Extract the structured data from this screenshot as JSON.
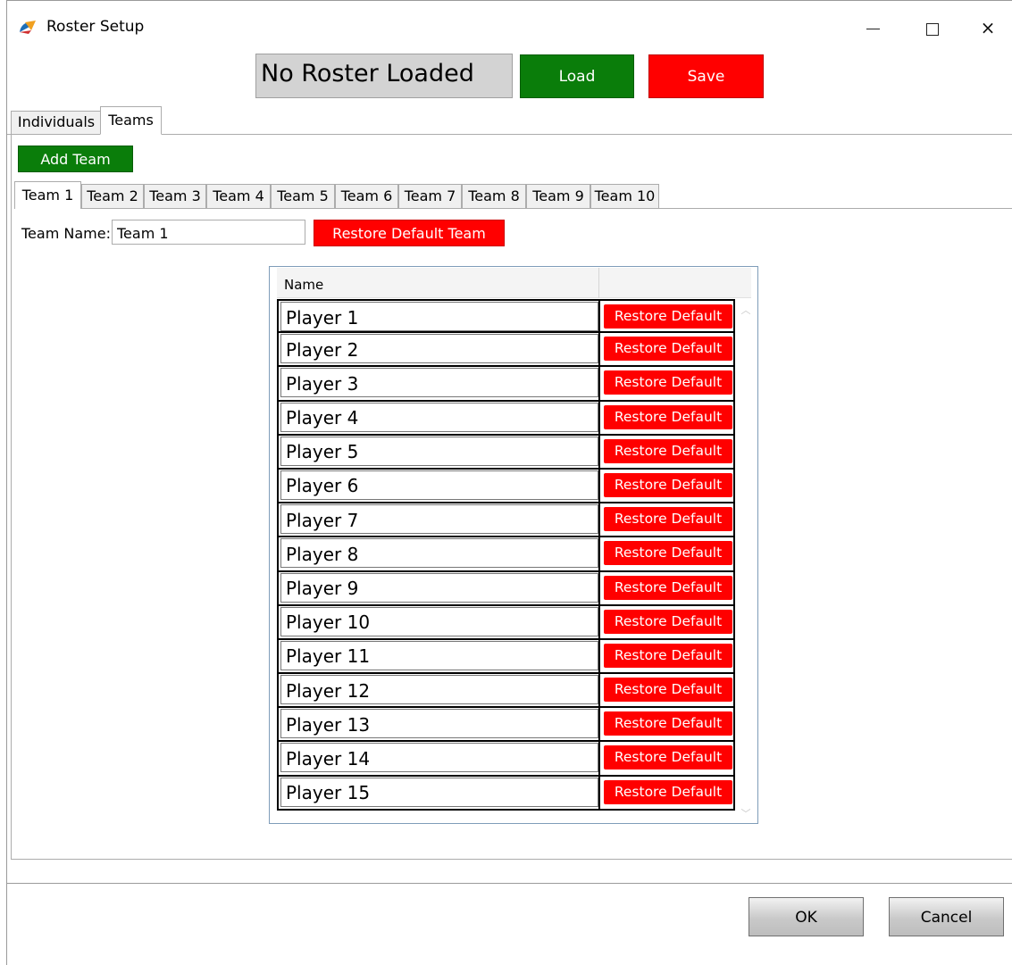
{
  "window": {
    "title": "Roster Setup",
    "minimize_label": "minimize",
    "maximize_label": "maximize",
    "close_label": "×"
  },
  "header": {
    "roster_status": "No Roster Loaded",
    "load_label": "Load",
    "save_label": "Save"
  },
  "main_tabs": [
    {
      "label": "Individuals",
      "active": false
    },
    {
      "label": "Teams",
      "active": true
    }
  ],
  "teams_panel": {
    "add_team_label": "Add Team",
    "team_tabs": [
      {
        "label": "Team 1",
        "active": true
      },
      {
        "label": "Team 2",
        "active": false
      },
      {
        "label": "Team 3",
        "active": false
      },
      {
        "label": "Team 4",
        "active": false
      },
      {
        "label": "Team 5",
        "active": false
      },
      {
        "label": "Team 6",
        "active": false
      },
      {
        "label": "Team 7",
        "active": false
      },
      {
        "label": "Team 8",
        "active": false
      },
      {
        "label": "Team 9",
        "active": false
      },
      {
        "label": "Team 10",
        "active": false
      }
    ],
    "team_name_label": "Team Name:",
    "team_name_value": "Team 1",
    "restore_team_label": "Restore Default Team",
    "grid": {
      "columns": [
        "Name",
        ""
      ],
      "restore_label": "Restore Default",
      "players": [
        "Player 1",
        "Player 2",
        "Player 3",
        "Player 4",
        "Player 5",
        "Player 6",
        "Player 7",
        "Player 8",
        "Player 9",
        "Player 10",
        "Player 11",
        "Player 12",
        "Player 13",
        "Player 14",
        "Player 15"
      ]
    }
  },
  "footer": {
    "ok_label": "OK",
    "cancel_label": "Cancel"
  },
  "colors": {
    "green": "#0a7d0a",
    "red": "#ff0000",
    "status_bg": "#d3d3d3"
  }
}
